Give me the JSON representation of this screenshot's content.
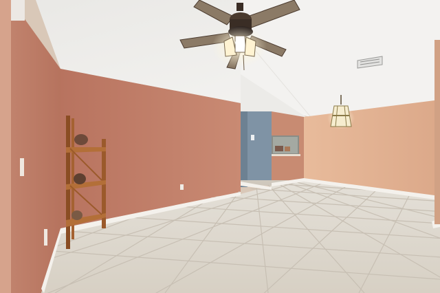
{
  "scene": {
    "description_colors": {
      "wall_coral": "#c07f6c",
      "wall_peach": "#e2b394",
      "ceiling": "#f1f0ee",
      "floor_tile": "#ddd7cd",
      "grout": "#c9c1b5",
      "baseboard": "#f4f1ec",
      "blue_wall": "#7f93a5",
      "ceiling_fan_blade": "#8b7a66",
      "fan_metal": "#3a2d25"
    },
    "icons": [
      "ceiling-fan-icon",
      "chandelier-icon",
      "shelf-icon",
      "outlet-icon",
      "light-switch-icon",
      "vent-icon"
    ]
  }
}
